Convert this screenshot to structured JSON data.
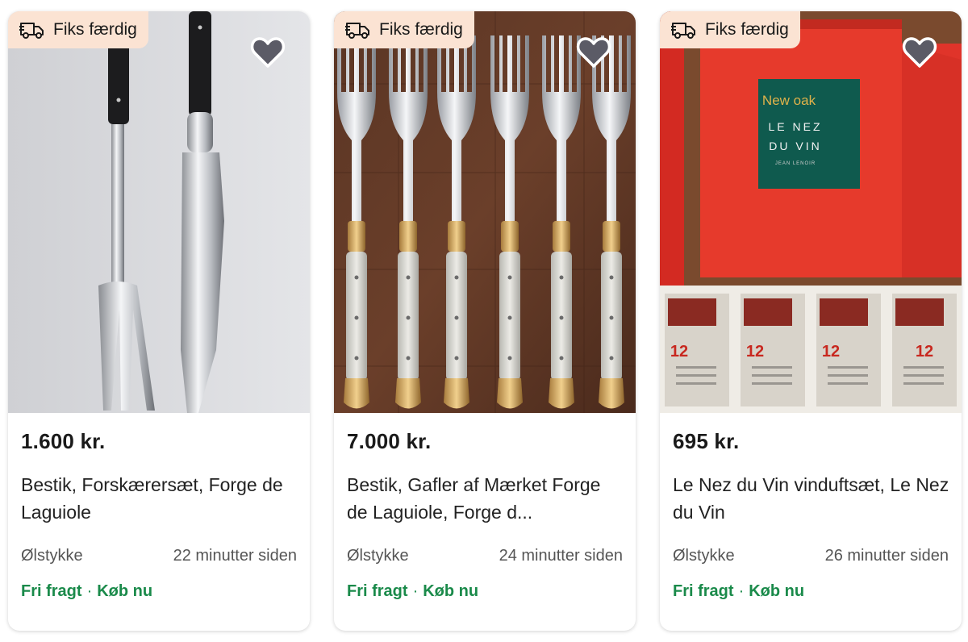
{
  "listings": [
    {
      "badge": "Fiks færdig",
      "price": "1.600 kr.",
      "title": "Bestik, Forskærersæt, Forge de Laguiole",
      "location": "Ølstykke",
      "time": "22 minutter siden",
      "shipping": "Fri fragt",
      "separator": "·",
      "buy": "Køb nu",
      "image_icon": "carving-set-photo"
    },
    {
      "badge": "Fiks færdig",
      "price": "7.000 kr.",
      "title": "Bestik, Gafler af Mærket Forge de Laguiole, Forge d...",
      "location": "Ølstykke",
      "time": "24 minutter siden",
      "shipping": "Fri fragt",
      "separator": "·",
      "buy": "Køb nu",
      "image_icon": "forks-photo"
    },
    {
      "badge": "Fiks færdig",
      "price": "695 kr.",
      "title": "Le Nez du Vin vinduftsæt, Le Nez du Vin",
      "location": "Ølstykke",
      "time": "26 minutter siden",
      "shipping": "Fri fragt",
      "separator": "·",
      "buy": "Køb nu",
      "image_icon": "wine-aroma-kit-photo",
      "image_text": {
        "brand_line1": "New oak",
        "brand_line2": "LE NEZ",
        "brand_line3": "DU VIN",
        "author": "JEAN LENOIR",
        "number": "12"
      }
    }
  ],
  "colors": {
    "badge_bg": "#fbe3d3",
    "shipping_green": "#1a8a4a",
    "heart_fill": "#5b5b66"
  }
}
